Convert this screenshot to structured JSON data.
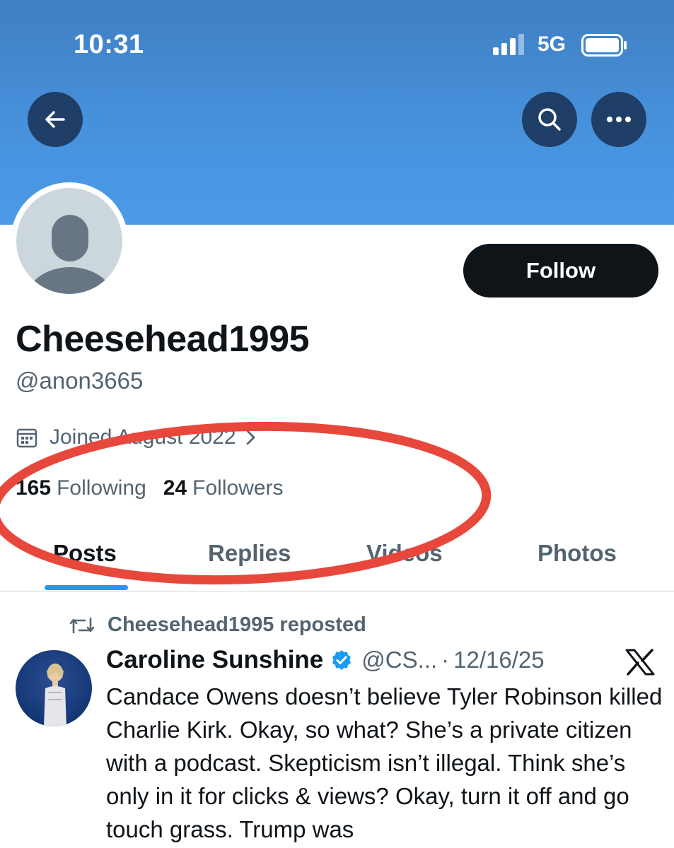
{
  "status_bar": {
    "time": "10:31",
    "network": "5G"
  },
  "profile": {
    "display_name": "Cheesehead1995",
    "handle": "@anon3665",
    "joined": "Joined August 2022",
    "following_count": "165",
    "following_label": "Following",
    "followers_count": "24",
    "followers_label": "Followers",
    "follow_button": "Follow"
  },
  "tabs": [
    {
      "label": "Posts",
      "active": true
    },
    {
      "label": "Replies",
      "active": false
    },
    {
      "label": "Videos",
      "active": false
    },
    {
      "label": "Photos",
      "active": false
    }
  ],
  "post": {
    "repost_label": "Cheesehead1995 reposted",
    "author": "Caroline Sunshine",
    "handle": "@CS...",
    "separator": "·",
    "date": "12/16/25",
    "text": "Candace Owens doesn’t believe Tyler Robinson killed Charlie Kirk. Okay, so what? She’s a private citizen with a podcast. Skepticism isn’t illegal. Think she’s only in it for clicks & views? Okay, turn it off and go touch grass. Trump was"
  },
  "icons": {
    "back": "back-arrow-icon",
    "search": "search-icon",
    "more": "more-dots-icon",
    "calendar": "calendar-icon",
    "repost": "repost-icon",
    "verified": "verified-badge-icon",
    "platform": "x-logo-icon"
  },
  "colors": {
    "banner": "#4791dc",
    "follow_button": "#0f1419",
    "tab_indicator": "#1d9bf0",
    "annotation_circle": "#e8473c",
    "verified": "#1d9bf0"
  }
}
